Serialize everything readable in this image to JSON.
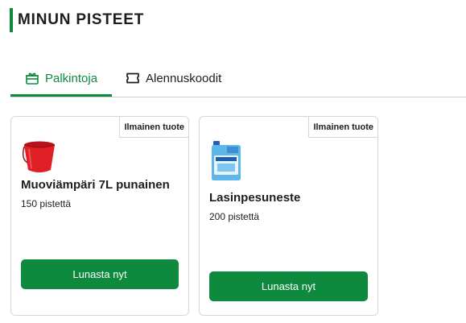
{
  "header": {
    "title": "MINUN PISTEET"
  },
  "tabs": [
    {
      "label": "Palkintoja",
      "icon": "gift-icon",
      "active": true
    },
    {
      "label": "Alennuskoodit",
      "icon": "ticket-icon",
      "active": false
    }
  ],
  "rewards": [
    {
      "badge": "Ilmainen tuote",
      "name": "Muoviämpäri 7L punainen",
      "points": "150 pistettä",
      "button": "Lunasta nyt",
      "image": "red-bucket"
    },
    {
      "badge": "Ilmainen tuote",
      "name": "Lasinpesuneste",
      "points": "200 pistettä",
      "button": "Lunasta nyt",
      "image": "washer-fluid-canister"
    }
  ],
  "colors": {
    "accent": "#0e8a3e"
  }
}
